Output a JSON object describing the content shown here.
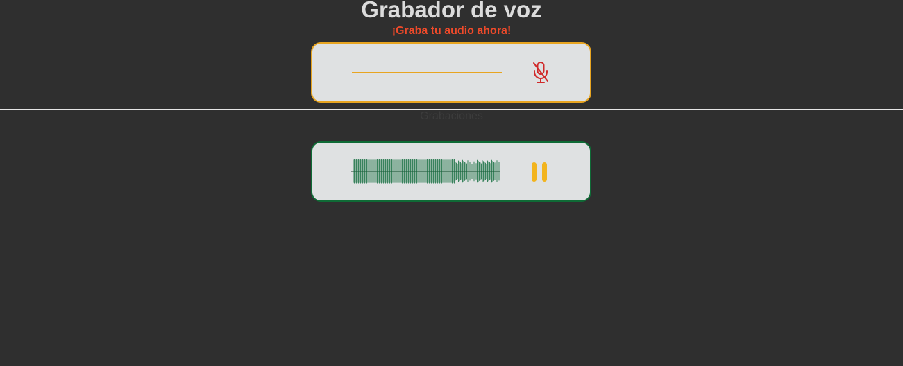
{
  "header": {
    "title": "Grabador de voz",
    "subtitle": "¡Graba tu audio ahora!"
  },
  "recorder": {
    "mic_icon": "mic-off-icon",
    "border_color": "#e8a521",
    "icon_color": "#d02a2a"
  },
  "recordings": {
    "section_label": "Grabaciones"
  },
  "player": {
    "state_icon": "pause-icon",
    "border_color": "#0f6b36",
    "waveform_color": "#0d6b3a",
    "pause_color": "#f2b41e"
  }
}
